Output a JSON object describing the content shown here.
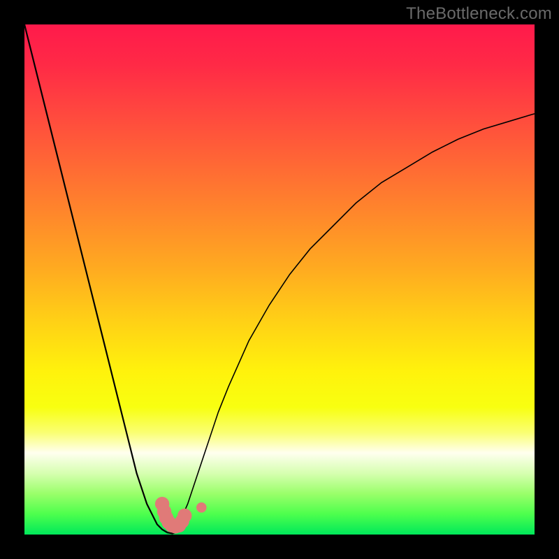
{
  "watermark": "TheBottleneck.com",
  "colors": {
    "frame": "#000000",
    "gradient_top": "#ff1a4b",
    "gradient_bottom": "#00e85a",
    "curve_stroke": "#000000",
    "marker_fill": "#e07a78"
  },
  "chart_data": {
    "type": "line",
    "title": "",
    "xlabel": "",
    "ylabel": "",
    "xlim": [
      0,
      100
    ],
    "ylim": [
      0,
      100
    ],
    "grid": false,
    "series": [
      {
        "name": "left-curve",
        "x": [
          0,
          2,
          4,
          6,
          8,
          10,
          12,
          14,
          16,
          18,
          20,
          22,
          24,
          25,
          26,
          27,
          28,
          29,
          30,
          31
        ],
        "y": [
          100,
          92,
          84,
          76,
          68,
          60,
          52,
          44,
          36,
          28,
          20,
          12,
          6,
          4,
          2,
          1,
          0.4,
          0.2,
          0.5,
          1.5
        ]
      },
      {
        "name": "right-curve",
        "x": [
          29,
          30,
          32,
          34,
          36,
          38,
          40,
          44,
          48,
          52,
          56,
          60,
          65,
          70,
          75,
          80,
          85,
          90,
          95,
          100
        ],
        "y": [
          0.2,
          1.5,
          6,
          12,
          18,
          24,
          29,
          38,
          45,
          51,
          56,
          60,
          65,
          69,
          72,
          75,
          77.5,
          79.5,
          81,
          82.5
        ]
      }
    ],
    "markers": [
      {
        "name": "left-marker-1",
        "x": 27.0,
        "y": 6.0,
        "r": 1.4
      },
      {
        "name": "left-marker-2",
        "x": 27.4,
        "y": 4.5,
        "r": 1.4
      },
      {
        "name": "left-marker-3",
        "x": 27.8,
        "y": 3.3,
        "r": 1.4
      },
      {
        "name": "left-marker-4",
        "x": 28.3,
        "y": 2.4,
        "r": 1.4
      },
      {
        "name": "left-marker-5",
        "x": 28.9,
        "y": 1.8,
        "r": 1.4
      },
      {
        "name": "left-marker-6",
        "x": 29.6,
        "y": 1.6,
        "r": 1.4
      },
      {
        "name": "left-marker-7",
        "x": 30.3,
        "y": 1.8,
        "r": 1.4
      },
      {
        "name": "left-marker-8",
        "x": 30.9,
        "y": 2.6,
        "r": 1.4
      },
      {
        "name": "left-marker-9",
        "x": 31.4,
        "y": 3.7,
        "r": 1.4
      },
      {
        "name": "right-marker-1",
        "x": 34.7,
        "y": 5.3,
        "r": 1.0
      }
    ]
  }
}
